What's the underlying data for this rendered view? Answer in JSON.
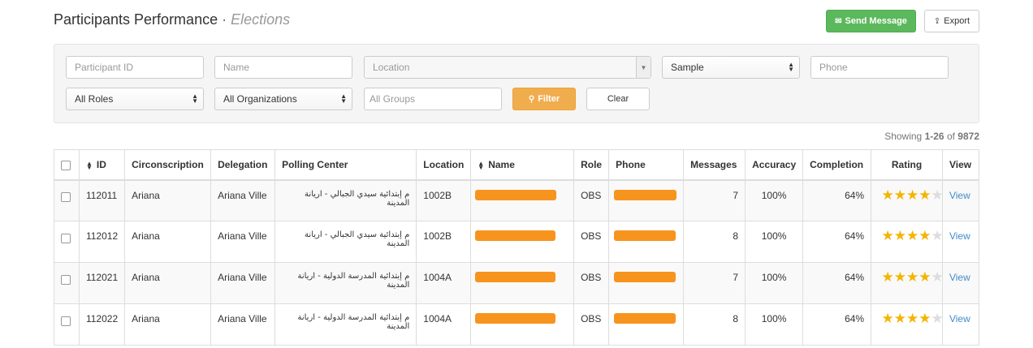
{
  "header": {
    "title": "Participants Performance",
    "separator": "·",
    "subtitle": "Elections",
    "send_message_label": "Send Message",
    "export_label": "Export"
  },
  "filters": {
    "participant_id_placeholder": "Participant ID",
    "name_placeholder": "Name",
    "location_placeholder": "Location",
    "sample_value": "Sample",
    "phone_placeholder": "Phone",
    "roles_value": "All Roles",
    "organizations_value": "All Organizations",
    "groups_placeholder": "All Groups",
    "filter_label": "Filter",
    "clear_label": "Clear"
  },
  "pagination": {
    "prefix": "Showing",
    "range": "1-26",
    "of": "of",
    "total": "9872"
  },
  "table": {
    "columns": [
      "ID",
      "Circonscription",
      "Delegation",
      "Polling Center",
      "Location",
      "Name",
      "Role",
      "Phone",
      "Messages",
      "Accuracy",
      "Completion",
      "Rating",
      "View"
    ],
    "rows": [
      {
        "id": "112011",
        "circonscription": "Ariana",
        "delegation": "Ariana Ville",
        "polling_center": "م إبتدائية سيدي الجبالي - اريانة المدينة",
        "location": "1002B",
        "role": "OBS",
        "messages": "7",
        "accuracy": "100%",
        "completion": "64%",
        "rating": 4,
        "view": "View"
      },
      {
        "id": "112012",
        "circonscription": "Ariana",
        "delegation": "Ariana Ville",
        "polling_center": "م إبتدائية سيدي الجبالي - اريانة المدينة",
        "location": "1002B",
        "role": "OBS",
        "messages": "8",
        "accuracy": "100%",
        "completion": "64%",
        "rating": 4,
        "view": "View"
      },
      {
        "id": "112021",
        "circonscription": "Ariana",
        "delegation": "Ariana Ville",
        "polling_center": "م إبتدائية المدرسة الدولية - اريانة المدينة",
        "location": "1004A",
        "role": "OBS",
        "messages": "7",
        "accuracy": "100%",
        "completion": "64%",
        "rating": 4,
        "view": "View"
      },
      {
        "id": "112022",
        "circonscription": "Ariana",
        "delegation": "Ariana Ville",
        "polling_center": "م إبتدائية المدرسة الدولية - اريانة المدينة",
        "location": "1004A",
        "role": "OBS",
        "messages": "8",
        "accuracy": "100%",
        "completion": "64%",
        "rating": 4,
        "view": "View"
      }
    ]
  },
  "colors": {
    "send_button": "#5cb85c",
    "filter_button": "#f0ad4e",
    "redaction": "#f7941e",
    "star": "#f5b400",
    "link": "#428bca"
  },
  "icons": [
    "envelope-icon",
    "export-icon",
    "search-icon",
    "sort-icon",
    "star-icon",
    "chevron-down-icon"
  ]
}
